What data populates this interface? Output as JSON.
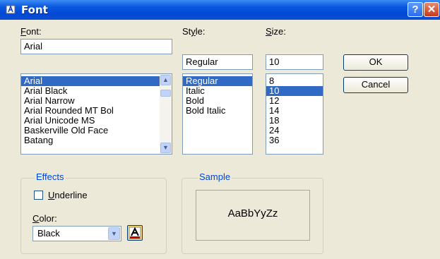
{
  "window": {
    "title": "Font"
  },
  "labels": {
    "font": "Font:",
    "font_mnemonic": "F",
    "font_rest": "ont:",
    "style": "Style:",
    "style_pre": "St",
    "style_mnemonic": "y",
    "style_rest": "le:",
    "size": "Size:",
    "size_mnemonic": "S",
    "size_rest": "ize:"
  },
  "font": {
    "value": "Arial",
    "items": [
      "Arial",
      "Arial Black",
      "Arial Narrow",
      "Arial Rounded MT Bol",
      "Arial Unicode MS",
      "Baskerville Old Face",
      "Batang"
    ],
    "selected_index": 0
  },
  "style": {
    "value": "Regular",
    "items": [
      "Regular",
      "Italic",
      "Bold",
      "Bold Italic"
    ],
    "selected_index": 0
  },
  "size": {
    "value": "10",
    "items": [
      "8",
      "10",
      "12",
      "14",
      "18",
      "24",
      "36"
    ],
    "selected_index": 1
  },
  "buttons": {
    "ok": "OK",
    "cancel": "Cancel"
  },
  "effects": {
    "title": "Effects",
    "underline_mnemonic": "U",
    "underline_rest": "nderline",
    "underline_checked": false,
    "color_mnemonic": "C",
    "color_rest": "olor:",
    "color_value": "Black"
  },
  "sample": {
    "title": "Sample",
    "text": "AaBbYyZz"
  },
  "icons": {
    "title": "font-dialog-icon",
    "help": "help-icon",
    "close": "close-icon",
    "color_picker": "text-color-icon"
  },
  "colors": {
    "titlebar": "#0348d6",
    "selection": "#316ac5",
    "group_title": "#0046d5"
  }
}
